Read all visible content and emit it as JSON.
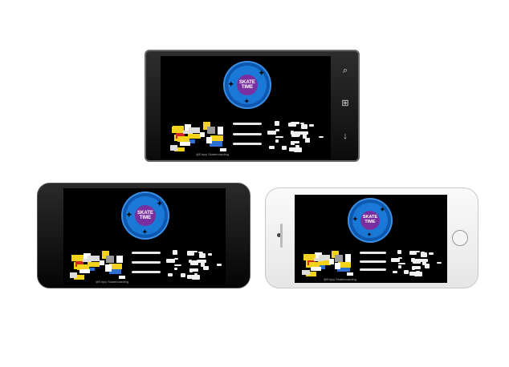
{
  "app": {
    "logo_line1": "SKATE",
    "logo_line2": "TIME",
    "credit": "@Enjoy Skateboarding"
  },
  "devices": [
    {
      "name": "windows-phone",
      "buttons": [
        "search-icon",
        "windows-logo-icon",
        "back-icon"
      ]
    },
    {
      "name": "android-phone"
    },
    {
      "name": "iphone"
    }
  ],
  "colors": {
    "logo_ring": "#1a78d6",
    "logo_center": "#7a2fa0",
    "screen_bg": "#000000",
    "accent_yellow": "#f2d21a",
    "accent_red": "#d22828"
  }
}
